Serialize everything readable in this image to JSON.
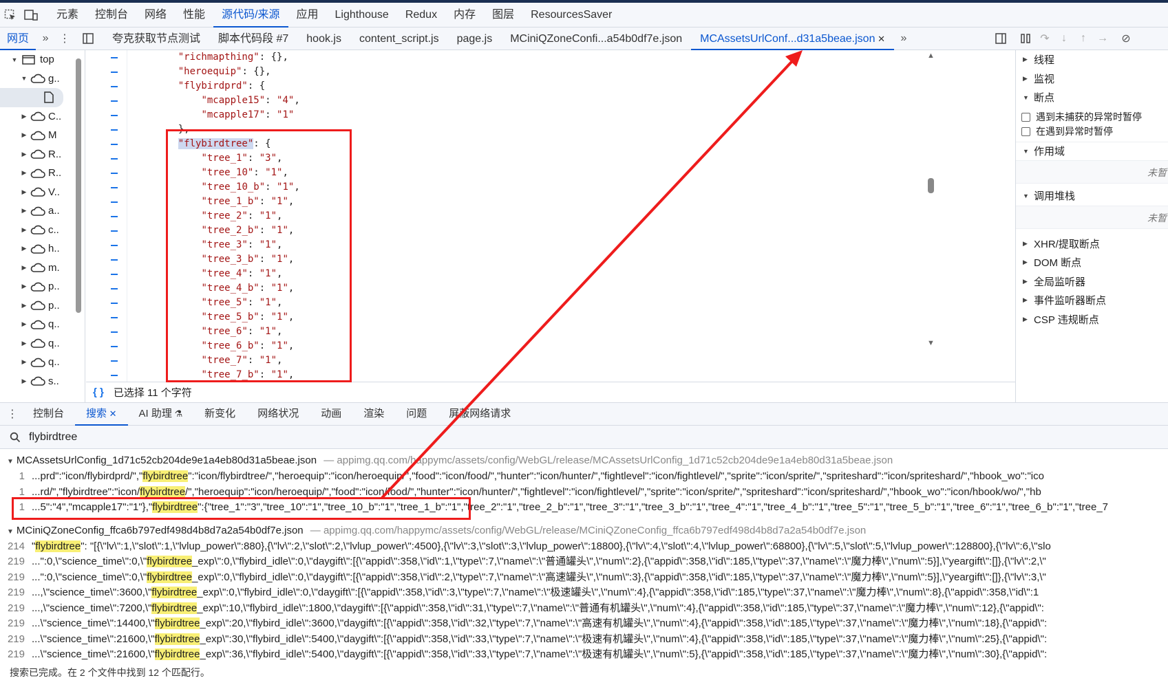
{
  "main_tabs": [
    "元素",
    "控制台",
    "网络",
    "性能",
    "源代码/来源",
    "应用",
    "Lighthouse",
    "Redux",
    "内存",
    "图层",
    "ResourcesSaver"
  ],
  "main_tab_active": 4,
  "navigator_label": "网页",
  "file_tabs": [
    "夸克获取节点测试",
    "脚本代码段 #7",
    "hook.js",
    "content_script.js",
    "page.js",
    "MCiniQZoneConfi...a54b0df7e.json",
    "MCAssetsUrlConf...d31a5beae.json"
  ],
  "file_tab_active": 6,
  "nav_tree": {
    "top_label": "top",
    "items": [
      {
        "label": "g..",
        "expanded": true
      },
      {
        "label": "C.."
      },
      {
        "label": "M"
      },
      {
        "label": "R.."
      },
      {
        "label": "R.."
      },
      {
        "label": "V.."
      },
      {
        "label": "a.."
      },
      {
        "label": "c.."
      },
      {
        "label": "h.."
      },
      {
        "label": "m."
      },
      {
        "label": "p.."
      },
      {
        "label": "p.."
      },
      {
        "label": "q.."
      },
      {
        "label": "q.."
      },
      {
        "label": "q.."
      },
      {
        "label": "s.."
      }
    ]
  },
  "code_lines": [
    {
      "indent": "    ",
      "key": "\"richmapthing\"",
      "rest": ": {},"
    },
    {
      "indent": "    ",
      "key": "\"heroequip\"",
      "rest": ": {},"
    },
    {
      "indent": "    ",
      "key": "\"flybirdprd\"",
      "rest": ": {"
    },
    {
      "indent": "        ",
      "key": "\"mcapple15\"",
      "rest": ": ",
      "val": "\"4\"",
      "tail": ","
    },
    {
      "indent": "        ",
      "key": "\"mcapple17\"",
      "rest": ": ",
      "val": "\"1\"",
      "tail": ""
    },
    {
      "indent": "    ",
      "key": "",
      "rest": "},"
    },
    {
      "indent": "    ",
      "key": "\"flybirdtree\"",
      "rest": ": {",
      "highlight": true
    },
    {
      "indent": "        ",
      "key": "\"tree_1\"",
      "rest": ": ",
      "val": "\"3\"",
      "tail": ","
    },
    {
      "indent": "        ",
      "key": "\"tree_10\"",
      "rest": ": ",
      "val": "\"1\"",
      "tail": ","
    },
    {
      "indent": "        ",
      "key": "\"tree_10_b\"",
      "rest": ": ",
      "val": "\"1\"",
      "tail": ","
    },
    {
      "indent": "        ",
      "key": "\"tree_1_b\"",
      "rest": ": ",
      "val": "\"1\"",
      "tail": ","
    },
    {
      "indent": "        ",
      "key": "\"tree_2\"",
      "rest": ": ",
      "val": "\"1\"",
      "tail": ","
    },
    {
      "indent": "        ",
      "key": "\"tree_2_b\"",
      "rest": ": ",
      "val": "\"1\"",
      "tail": ","
    },
    {
      "indent": "        ",
      "key": "\"tree_3\"",
      "rest": ": ",
      "val": "\"1\"",
      "tail": ","
    },
    {
      "indent": "        ",
      "key": "\"tree_3_b\"",
      "rest": ": ",
      "val": "\"1\"",
      "tail": ","
    },
    {
      "indent": "        ",
      "key": "\"tree_4\"",
      "rest": ": ",
      "val": "\"1\"",
      "tail": ","
    },
    {
      "indent": "        ",
      "key": "\"tree_4_b\"",
      "rest": ": ",
      "val": "\"1\"",
      "tail": ","
    },
    {
      "indent": "        ",
      "key": "\"tree_5\"",
      "rest": ": ",
      "val": "\"1\"",
      "tail": ","
    },
    {
      "indent": "        ",
      "key": "\"tree_5_b\"",
      "rest": ": ",
      "val": "\"1\"",
      "tail": ","
    },
    {
      "indent": "        ",
      "key": "\"tree_6\"",
      "rest": ": ",
      "val": "\"1\"",
      "tail": ","
    },
    {
      "indent": "        ",
      "key": "\"tree_6_b\"",
      "rest": ": ",
      "val": "\"1\"",
      "tail": ","
    },
    {
      "indent": "        ",
      "key": "\"tree_7\"",
      "rest": ": ",
      "val": "\"1\"",
      "tail": ","
    },
    {
      "indent": "        ",
      "key": "\"tree_7_b\"",
      "rest": ": ",
      "val": "\"1\"",
      "tail": ","
    }
  ],
  "editor_status": "已选择 11 个字符",
  "debugger": {
    "sections_top": [
      {
        "label": "线程",
        "open": false
      },
      {
        "label": "监视",
        "open": false
      },
      {
        "label": "断点",
        "open": true
      }
    ],
    "checkboxes": [
      "遇到未捕获的异常时暂停",
      "在遇到异常时暂停"
    ],
    "scope_label": "作用域",
    "scope_empty": "未暂",
    "callstack_label": "调用堆栈",
    "callstack_empty": "未暂",
    "sections_bottom": [
      "XHR/提取断点",
      "DOM 断点",
      "全局监听器",
      "事件监听器断点",
      "CSP 违规断点"
    ]
  },
  "drawer_tabs": [
    "控制台",
    "搜索",
    "AI 助理",
    "新变化",
    "网络状况",
    "动画",
    "渲染",
    "问题",
    "屏蔽网络请求"
  ],
  "drawer_tab_active": 1,
  "search_query": "flybirdtree",
  "results": [
    {
      "file": "MCAssetsUrlConfig_1d71c52cb204de9e1a4eb80d31a5beae.json",
      "url": "appimg.qq.com/happymc/assets/config/WebGL/release/MCAssetsUrlConfig_1d71c52cb204de9e1a4eb80d31a5beae.json",
      "lines": [
        {
          "ln": "1",
          "pre": "...prd\":\"icon/flybirdprd/\",\"",
          "match": "flybirdtree",
          "post": "\":\"icon/flybirdtree/\",\"heroequip\":\"icon/heroequip/\",\"food\":\"icon/food/\",\"hunter\":\"icon/hunter/\",\"fightlevel\":\"icon/fightlevel/\",\"sprite\":\"icon/sprite/\",\"spriteshard\":\"icon/spriteshard/\",\"hbook_wo\":\"ico"
        },
        {
          "ln": "1",
          "pre": "...rd/\",\"flybirdtree\":\"icon/",
          "match": "flybirdtree",
          "post": "/\",\"heroequip\":\"icon/heroequip/\",\"food\":\"icon/food/\",\"hunter\":\"icon/hunter/\",\"fightlevel\":\"icon/fightlevel/\",\"sprite\":\"icon/sprite/\",\"spriteshard\":\"icon/spriteshard/\",\"hbook_wo\":\"icon/hbook/wo/\",\"hb"
        },
        {
          "ln": "1",
          "pre": "...5\":\"4\",\"mcapple17\":\"1\"},\"",
          "match": "flybirdtree",
          "post": "\":{\"tree_1\":\"3\",\"tree_10\":\"1\",\"tree_10_b\":\"1\",\"tree_1_b\":\"1\",\"tree_2\":\"1\",\"tree_2_b\":\"1\",\"tree_3\":\"1\",\"tree_3_b\":\"1\",\"tree_4\":\"1\",\"tree_4_b\":\"1\",\"tree_5\":\"1\",\"tree_5_b\":\"1\",\"tree_6\":\"1\",\"tree_6_b\":\"1\",\"tree_7"
        }
      ]
    },
    {
      "file": "MCiniQZoneConfig_ffca6b797edf498d4b8d7a2a54b0df7e.json",
      "url": "appimg.qq.com/happymc/assets/config/WebGL/release/MCiniQZoneConfig_ffca6b797edf498d4b8d7a2a54b0df7e.json",
      "lines": [
        {
          "ln": "214",
          "pre": "\"",
          "match": "flybirdtree",
          "post": "\": \"[{\\\"lv\\\":1,\\\"slot\\\":1,\\\"lvlup_power\\\":880},{\\\"lv\\\":2,\\\"slot\\\":2,\\\"lvlup_power\\\":4500},{\\\"lv\\\":3,\\\"slot\\\":3,\\\"lvlup_power\\\":18800},{\\\"lv\\\":4,\\\"slot\\\":4,\\\"lvlup_power\\\":68800},{\\\"lv\\\":5,\\\"slot\\\":5,\\\"lvlup_power\\\":128800},{\\\"lv\\\":6,\\\"slo"
        },
        {
          "ln": "219",
          "pre": "...\":0,\\\"science_time\\\":0,\\\"",
          "match": "flybirdtree",
          "post": "_exp\\\":0,\\\"flybird_idle\\\":0,\\\"daygift\\\":[{\\\"appid\\\":358,\\\"id\\\":1,\\\"type\\\":7,\\\"name\\\":\\\"普通罐头\\\",\\\"num\\\":2},{\\\"appid\\\":358,\\\"id\\\":185,\\\"type\\\":37,\\\"name\\\":\\\"魔力棒\\\",\\\"num\\\":5}],\\\"yeargift\\\":[]},{\\\"lv\\\":2,\\\""
        },
        {
          "ln": "219",
          "pre": "...\":0,\\\"science_time\\\":0,\\\"",
          "match": "flybirdtree",
          "post": "_exp\\\":0,\\\"flybird_idle\\\":0,\\\"daygift\\\":[{\\\"appid\\\":358,\\\"id\\\":2,\\\"type\\\":7,\\\"name\\\":\\\"高速罐头\\\",\\\"num\\\":3},{\\\"appid\\\":358,\\\"id\\\":185,\\\"type\\\":37,\\\"name\\\":\\\"魔力棒\\\",\\\"num\\\":5}],\\\"yeargift\\\":[]},{\\\"lv\\\":3,\\\""
        },
        {
          "ln": "219",
          "pre": "...,\\\"science_time\\\":3600,\\\"",
          "match": "flybirdtree",
          "post": "_exp\\\":0,\\\"flybird_idle\\\":0,\\\"daygift\\\":[{\\\"appid\\\":358,\\\"id\\\":3,\\\"type\\\":7,\\\"name\\\":\\\"极速罐头\\\",\\\"num\\\":4},{\\\"appid\\\":358,\\\"id\\\":185,\\\"type\\\":37,\\\"name\\\":\\\"魔力棒\\\",\\\"num\\\":8},{\\\"appid\\\":358,\\\"id\\\":1"
        },
        {
          "ln": "219",
          "pre": "...,\\\"science_time\\\":7200,\\\"",
          "match": "flybirdtree",
          "post": "_exp\\\":10,\\\"flybird_idle\\\":1800,\\\"daygift\\\":[{\\\"appid\\\":358,\\\"id\\\":31,\\\"type\\\":7,\\\"name\\\":\\\"普通有机罐头\\\",\\\"num\\\":4},{\\\"appid\\\":358,\\\"id\\\":185,\\\"type\\\":37,\\\"name\\\":\\\"魔力棒\\\",\\\"num\\\":12},{\\\"appid\\\":"
        },
        {
          "ln": "219",
          "pre": "...\\\"science_time\\\":14400,\\\"",
          "match": "flybirdtree",
          "post": "_exp\\\":20,\\\"flybird_idle\\\":3600,\\\"daygift\\\":[{\\\"appid\\\":358,\\\"id\\\":32,\\\"type\\\":7,\\\"name\\\":\\\"高速有机罐头\\\",\\\"num\\\":4},{\\\"appid\\\":358,\\\"id\\\":185,\\\"type\\\":37,\\\"name\\\":\\\"魔力棒\\\",\\\"num\\\":18},{\\\"appid\\\":"
        },
        {
          "ln": "219",
          "pre": "...\\\"science_time\\\":21600,\\\"",
          "match": "flybirdtree",
          "post": "_exp\\\":30,\\\"flybird_idle\\\":5400,\\\"daygift\\\":[{\\\"appid\\\":358,\\\"id\\\":33,\\\"type\\\":7,\\\"name\\\":\\\"极速有机罐头\\\",\\\"num\\\":4},{\\\"appid\\\":358,\\\"id\\\":185,\\\"type\\\":37,\\\"name\\\":\\\"魔力棒\\\",\\\"num\\\":25},{\\\"appid\\\":"
        },
        {
          "ln": "219",
          "pre": "...\\\"science_time\\\":21600,\\\"",
          "match": "flybirdtree",
          "post": "_exp\\\":36,\\\"flybird_idle\\\":5400,\\\"daygift\\\":[{\\\"appid\\\":358,\\\"id\\\":33,\\\"type\\\":7,\\\"name\\\":\\\"极速有机罐头\\\",\\\"num\\\":5},{\\\"appid\\\":358,\\\"id\\\":185,\\\"type\\\":37,\\\"name\\\":\\\"魔力棒\\\",\\\"num\\\":30},{\\\"appid\\\":"
        }
      ]
    }
  ],
  "search_status": "搜索已完成。在 2 个文件中找到 12 个匹配行。",
  "colors": {
    "accent": "#0b57d0",
    "annotation": "#ee1c1c",
    "match": "#f8ef75"
  }
}
